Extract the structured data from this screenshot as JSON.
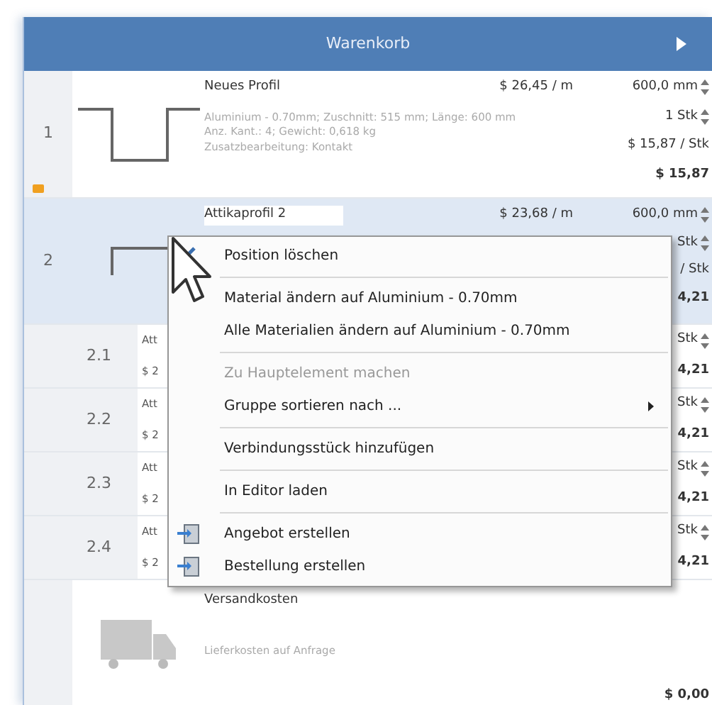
{
  "header": {
    "title": "Warenkorb"
  },
  "items": [
    {
      "number": "1",
      "name": "Neues Profil",
      "price": "$ 26,45 / m",
      "length": "600,0 mm",
      "quantity": "1 Stk",
      "unit_price": "$ 15,87 / Stk",
      "total": "$ 15,87",
      "details": [
        "Aluminium - 0.70mm; Zuschnitt: 515 mm; Länge: 600 mm",
        "Anz. Kant.: 4; Gewicht: 0,618 kg",
        "Zusatzbearbeitung: Kontakt"
      ],
      "selected": false,
      "tagged": true
    },
    {
      "number": "2",
      "name": "Attikaprofil 2",
      "price": "$ 23,68 / m",
      "length": "600,0 mm",
      "quantity": "Stk",
      "unit_price": "/ Stk",
      "total": "4,21",
      "selected": true,
      "tagged": false,
      "children": [
        {
          "number": "2.1",
          "name": "Att",
          "price": "$ 2",
          "quantity": "Stk",
          "total": "4,21"
        },
        {
          "number": "2.2",
          "name": "Att",
          "price": "$ 2",
          "quantity": "Stk",
          "total": "4,21"
        },
        {
          "number": "2.3",
          "name": "Att",
          "price": "$ 2",
          "quantity": "Stk",
          "total": "4,21"
        },
        {
          "number": "2.4",
          "name": "Att",
          "price": "$ 2",
          "quantity": "Stk",
          "total": "4,21"
        }
      ]
    }
  ],
  "shipping": {
    "title": "Versandkosten",
    "note": "Lieferkosten auf Anfrage",
    "total": "$ 0,00"
  },
  "context_menu": [
    {
      "kind": "delete_item",
      "label": "Position löschen",
      "disabled": false,
      "submenu": false
    },
    {
      "kind": "separator"
    },
    {
      "kind": "item",
      "label": "Material ändern auf Aluminium - 0.70mm",
      "disabled": false,
      "submenu": false
    },
    {
      "kind": "item",
      "label": "Alle Materialien ändern auf Aluminium - 0.70mm",
      "disabled": false,
      "submenu": false
    },
    {
      "kind": "separator"
    },
    {
      "kind": "item",
      "label": "Zu Hauptelement machen",
      "disabled": true,
      "submenu": false
    },
    {
      "kind": "item",
      "label": "Gruppe sortieren nach ...",
      "disabled": false,
      "submenu": true
    },
    {
      "kind": "separator"
    },
    {
      "kind": "item",
      "label": "Verbindungsstück hinzufügen",
      "disabled": false,
      "submenu": false
    },
    {
      "kind": "separator"
    },
    {
      "kind": "item",
      "label": "In Editor laden",
      "disabled": false,
      "submenu": false
    },
    {
      "kind": "separator"
    },
    {
      "kind": "export_item",
      "label": "Angebot erstellen",
      "disabled": false,
      "submenu": false
    },
    {
      "kind": "export_item",
      "label": "Bestellung erstellen",
      "disabled": false,
      "submenu": false
    }
  ]
}
